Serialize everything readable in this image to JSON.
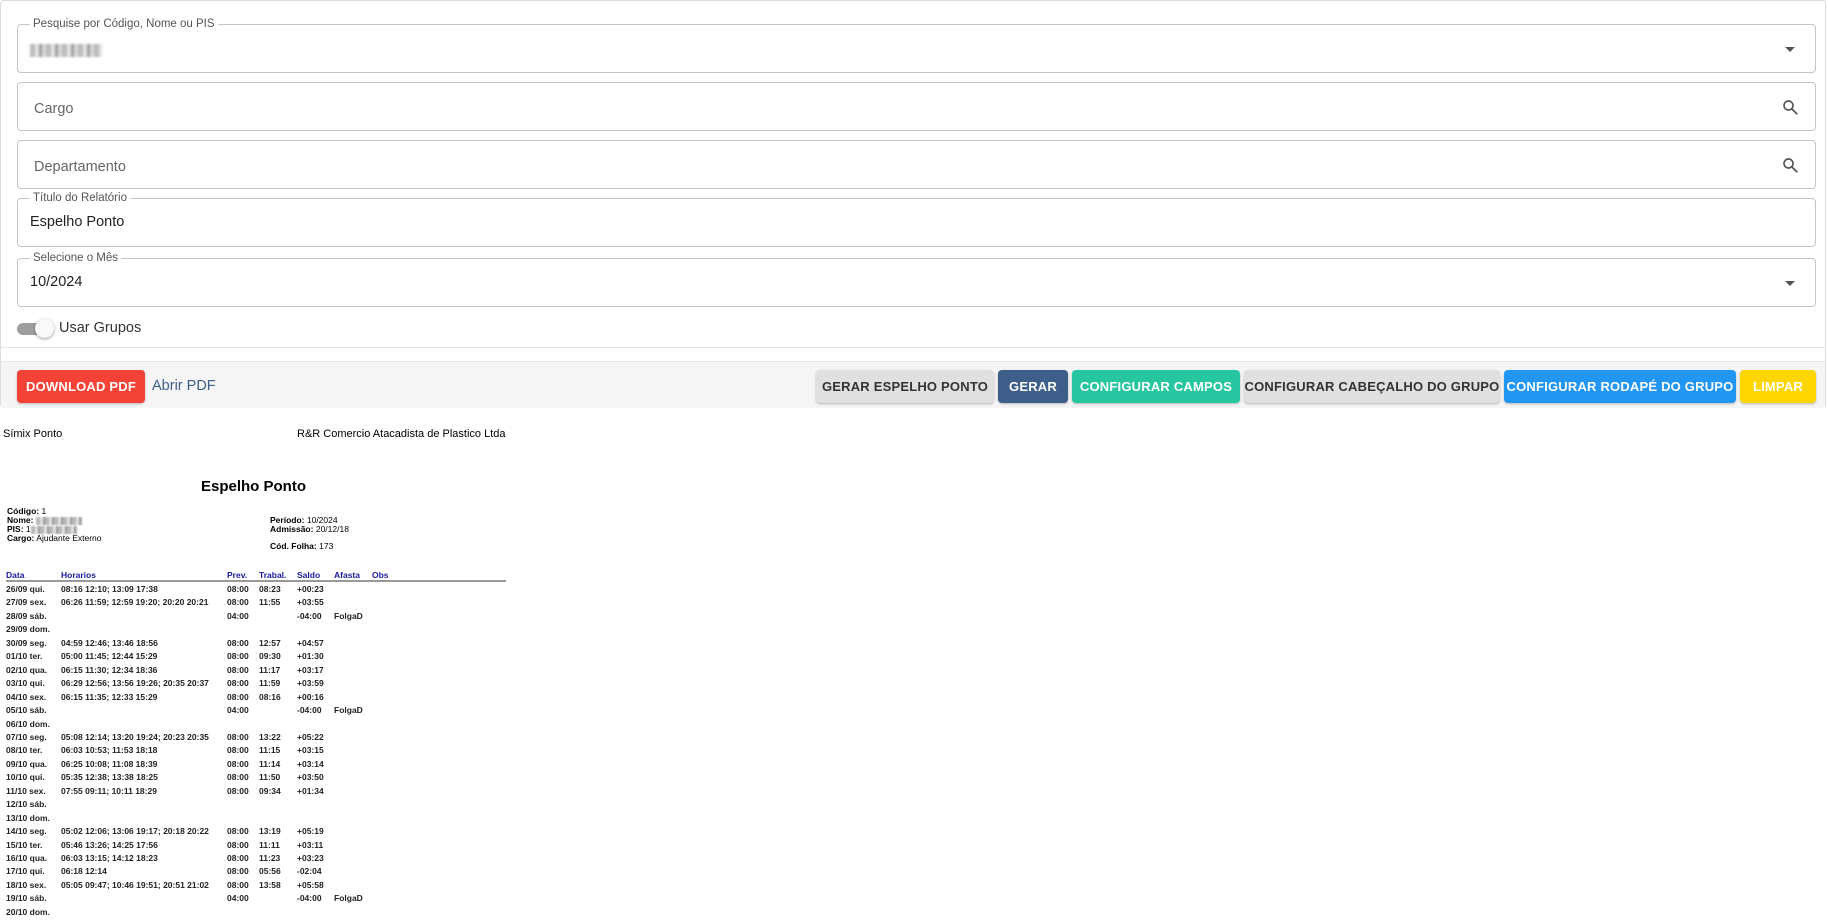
{
  "form": {
    "search": {
      "legend": "Pesquise por Código, Nome ou PIS"
    },
    "cargo": {
      "placeholder": "Cargo"
    },
    "departamento": {
      "placeholder": "Departamento"
    },
    "titulo": {
      "legend": "Título do Relatório",
      "value": "Espelho Ponto"
    },
    "mes": {
      "legend": "Selecione o Mês",
      "value": "10/2024"
    },
    "toggle": {
      "label": "Usar Grupos",
      "checked": false
    }
  },
  "actions": {
    "download_pdf": "DOWNLOAD PDF",
    "abrir_pdf": "Abrir PDF",
    "gerar_espelho": "GERAR ESPELHO PONTO",
    "gerar": "GERAR",
    "configurar_campos": "CONFIGURAR CAMPOS",
    "configurar_cabecalho": "CONFIGURAR CABEÇALHO DO GRUPO",
    "configurar_rodape": "CONFIGURAR RODAPÉ DO GRUPO",
    "limpar": "LIMPAR"
  },
  "colors": {
    "download_pdf": "#f44336",
    "gerar": "#3e5f8a",
    "configurar_campos": "#26c6a0",
    "configurar_rodape": "#2196f3",
    "limpar": "#ffd600",
    "gray_button": "#e0e0e0"
  },
  "report": {
    "system": "Símix Ponto",
    "company": "R&R Comercio Atacadista de Plastico Ltda",
    "title": "Espelho Ponto",
    "info": {
      "codigo_label": "Código:",
      "codigo": "1",
      "nome_label": "Nome:",
      "pis_label": "PIS:",
      "pis_prefix": "1",
      "cargo_label": "Cargo:",
      "cargo": "Ajudante Externo",
      "periodo_label": "Período:",
      "periodo": "10/2024",
      "admissao_label": "Admissão:",
      "admissao": "20/12/18",
      "cod_folha_label": "Cód. Folha:",
      "cod_folha": "173"
    },
    "columns": [
      "Data",
      "Horarios",
      "Prev.",
      "Trabal.",
      "Saldo",
      "Afasta",
      "Obs"
    ],
    "rows": [
      [
        "26/09 qui.",
        "08:16 12:10; 13:09 17:38",
        "08:00",
        "08:23",
        "+00:23",
        "",
        ""
      ],
      [
        "27/09 sex.",
        "06:26 11:59; 12:59 19:20; 20:20 20:21",
        "08:00",
        "11:55",
        "+03:55",
        "",
        ""
      ],
      [
        "28/09 sáb.",
        "",
        "04:00",
        "",
        "-04:00",
        "FolgaD",
        ""
      ],
      [
        "29/09 dom.",
        "",
        "",
        "",
        "",
        "",
        ""
      ],
      [
        "30/09 seg.",
        "04:59 12:46; 13:46 18:56",
        "08:00",
        "12:57",
        "+04:57",
        "",
        ""
      ],
      [
        "01/10 ter.",
        "05:00 11:45; 12:44 15:29",
        "08:00",
        "09:30",
        "+01:30",
        "",
        ""
      ],
      [
        "02/10 qua.",
        "06:15 11:30; 12:34 18:36",
        "08:00",
        "11:17",
        "+03:17",
        "",
        ""
      ],
      [
        "03/10 qui.",
        "06:29 12:56; 13:56 19:26; 20:35 20:37",
        "08:00",
        "11:59",
        "+03:59",
        "",
        ""
      ],
      [
        "04/10 sex.",
        "06:15 11:35; 12:33 15:29",
        "08:00",
        "08:16",
        "+00:16",
        "",
        ""
      ],
      [
        "05/10 sáb.",
        "",
        "04:00",
        "",
        "-04:00",
        "FolgaD",
        ""
      ],
      [
        "06/10 dom.",
        "",
        "",
        "",
        "",
        "",
        ""
      ],
      [
        "07/10 seg.",
        "05:08 12:14; 13:20 19:24; 20:23 20:35",
        "08:00",
        "13:22",
        "+05:22",
        "",
        ""
      ],
      [
        "08/10 ter.",
        "06:03 10:53; 11:53 18:18",
        "08:00",
        "11:15",
        "+03:15",
        "",
        ""
      ],
      [
        "09/10 qua.",
        "06:25 10:08; 11:08 18:39",
        "08:00",
        "11:14",
        "+03:14",
        "",
        ""
      ],
      [
        "10/10 qui.",
        "05:35 12:38; 13:38 18:25",
        "08:00",
        "11:50",
        "+03:50",
        "",
        ""
      ],
      [
        "11/10 sex.",
        "07:55 09:11; 10:11 18:29",
        "08:00",
        "09:34",
        "+01:34",
        "",
        ""
      ],
      [
        "12/10 sáb.",
        "",
        "",
        "",
        "",
        "",
        ""
      ],
      [
        "13/10 dom.",
        "",
        "",
        "",
        "",
        "",
        ""
      ],
      [
        "14/10 seg.",
        "05:02 12:06; 13:06 19:17; 20:18 20:22",
        "08:00",
        "13:19",
        "+05:19",
        "",
        ""
      ],
      [
        "15/10 ter.",
        "05:46 13:26; 14:25 17:56",
        "08:00",
        "11:11",
        "+03:11",
        "",
        ""
      ],
      [
        "16/10 qua.",
        "06:03 13:15; 14:12 18:23",
        "08:00",
        "11:23",
        "+03:23",
        "",
        ""
      ],
      [
        "17/10 qui.",
        "06:18 12:14",
        "08:00",
        "05:56",
        "-02:04",
        "",
        ""
      ],
      [
        "18/10 sex.",
        "05:05 09:47; 10:46 19:51; 20:51 21:02",
        "08:00",
        "13:58",
        "+05:58",
        "",
        ""
      ],
      [
        "19/10 sáb.",
        "",
        "04:00",
        "",
        "-04:00",
        "FolgaD",
        ""
      ],
      [
        "20/10 dom.",
        "",
        "",
        "",
        "",
        "",
        ""
      ]
    ]
  }
}
